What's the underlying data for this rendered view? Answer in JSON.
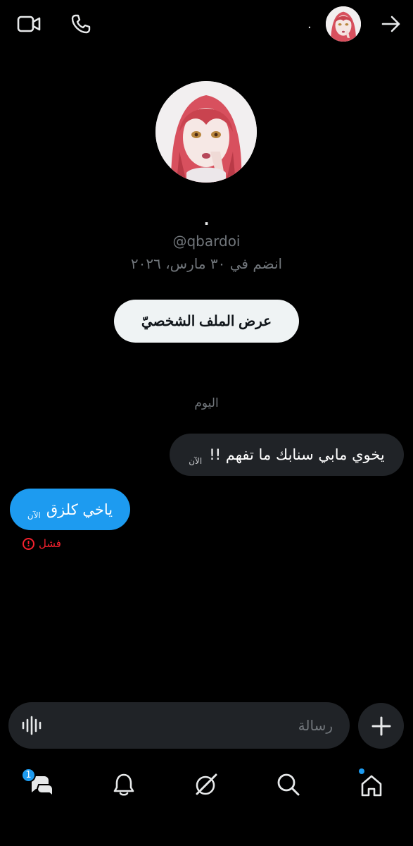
{
  "header": {
    "display_name": ".",
    "icons": [
      "video-call-icon",
      "phone-icon",
      "forward-arrow-icon"
    ]
  },
  "profile": {
    "name": ".",
    "handle": "@qbardoi",
    "joined": "انضم في ٣٠ مارس، ٢٠٢٦",
    "view_profile_label": "عرض الملف الشخصيّ"
  },
  "conversation": {
    "day_separator": "اليوم",
    "messages": [
      {
        "direction": "incoming",
        "text": "يخوي مابي سنابك ما تفهم !!",
        "time": "الآن"
      },
      {
        "direction": "outgoing",
        "text": "ياخي كلزق",
        "time": "الآن",
        "status": "فشل"
      }
    ]
  },
  "composer": {
    "placeholder": "رسالة"
  },
  "bottom_nav": {
    "items": [
      "messages-icon",
      "notifications-icon",
      "grok-icon",
      "search-icon",
      "home-icon"
    ],
    "messages_badge": "1"
  },
  "colors": {
    "background": "#000000",
    "accent": "#1d9bf0",
    "incoming_bubble": "#202327",
    "error": "#f4212e"
  }
}
